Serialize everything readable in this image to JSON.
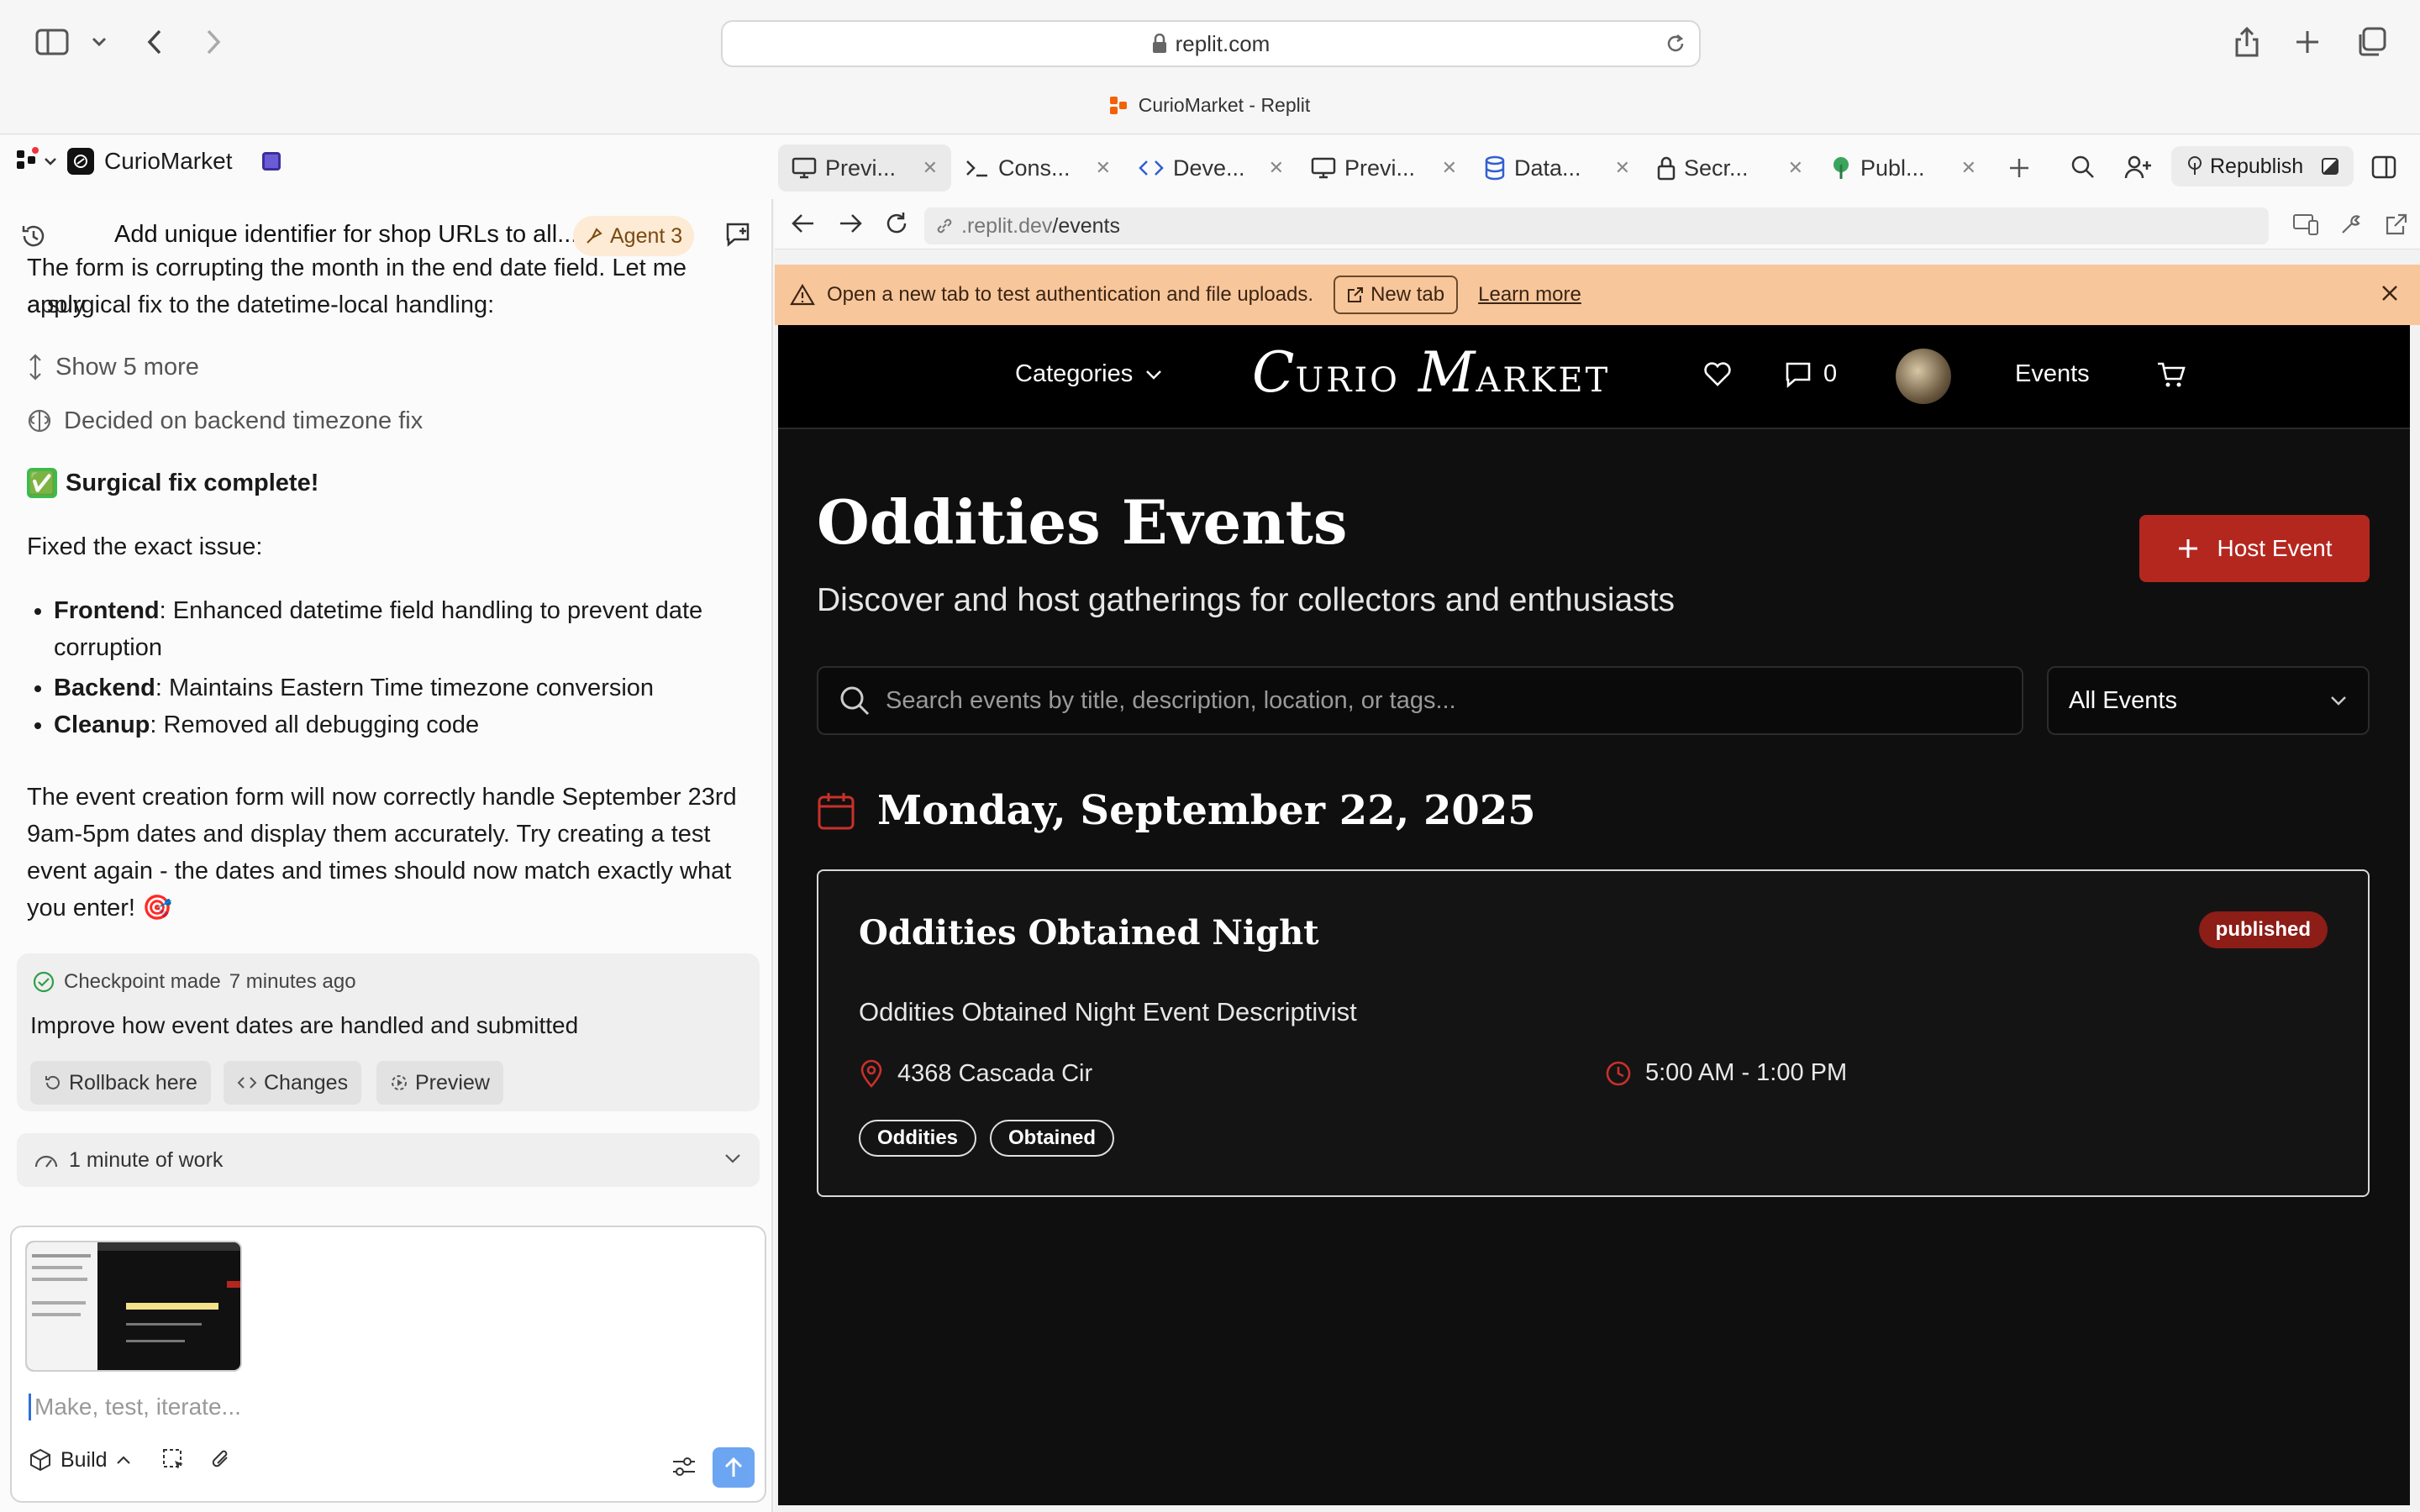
{
  "browser": {
    "url": "replit.com",
    "page_title": "CurioMarket - Replit"
  },
  "replit": {
    "project_name": "CurioMarket",
    "republish_label": "Republish",
    "tabs": [
      {
        "label": "Previ...",
        "icon": "monitor-icon"
      },
      {
        "label": "Cons...",
        "icon": "terminal-icon"
      },
      {
        "label": "Deve...",
        "icon": "code-icon"
      },
      {
        "label": "Previ...",
        "icon": "monitor-icon"
      },
      {
        "label": "Data...",
        "icon": "database-icon"
      },
      {
        "label": "Secr...",
        "icon": "lock-icon"
      },
      {
        "label": "Publ...",
        "icon": "publish-icon"
      }
    ]
  },
  "agent": {
    "thread_title": "Add unique identifier for shop URLs to all...",
    "agent_badge": "Agent 3",
    "intro_line1": "The form is corrupting the month in the end date field. Let me apply",
    "intro_line2": "a surgical fix to the datetime-local handling:",
    "show_more": "Show 5 more",
    "decided": "Decided on backend timezone fix",
    "success_emoji": "✅",
    "success_heading": "Surgical fix complete!",
    "fixed_intro": "Fixed the exact issue:",
    "bullets": [
      {
        "term": "Frontend",
        "text": ": Enhanced datetime field handling to prevent date corruption"
      },
      {
        "term": "Backend",
        "text": ": Maintains Eastern Time timezone conversion"
      },
      {
        "term": "Cleanup",
        "text": ": Removed all debugging code"
      }
    ],
    "summary": "The event creation form will now correctly handle September 23rd 9am-5pm dates and display them accurately. Try creating a test event again - the dates and times should now match exactly what you enter! 🎯",
    "checkpoint": {
      "label": "Checkpoint made",
      "time": "7 minutes ago",
      "description": "Improve how event dates are handled and submitted",
      "rollback": "Rollback here",
      "changes": "Changes",
      "preview": "Preview"
    },
    "work_summary": "1 minute of work",
    "composer_placeholder": "Make, test, iterate...",
    "build_label": "Build"
  },
  "preview": {
    "url_prefix": ".replit.dev",
    "url_path": "/events",
    "notice_text": "Open a new tab to test authentication and file uploads.",
    "new_tab_label": "New tab",
    "learn_more_label": "Learn more"
  },
  "site": {
    "nav_categories": "Categories",
    "logo_c": "C",
    "logo_urio": "URIO",
    "logo_m": "M",
    "logo_arket": "ARKET",
    "message_count": "0",
    "nav_events": "Events",
    "title": "Oddities Events",
    "subtitle": "Discover and host gatherings for collectors and enthusiasts",
    "host_button": "Host Event",
    "search_placeholder": "Search events by title, description, location, or tags...",
    "filter_value": "All Events",
    "date_heading": "Monday, September 22, 2025",
    "event": {
      "title": "Oddities Obtained Night",
      "status": "published",
      "description": "Oddities Obtained Night Event Descriptivist",
      "location": "4368 Cascada Cir",
      "time": "5:00 AM - 1:00 PM",
      "tags": [
        "Oddities",
        "Obtained"
      ]
    }
  },
  "colors": {
    "accent_red": "#b4271f",
    "notice_bg": "#f8c69b",
    "site_bg": "#0f0f0f",
    "replit_orange": "#f26207"
  }
}
